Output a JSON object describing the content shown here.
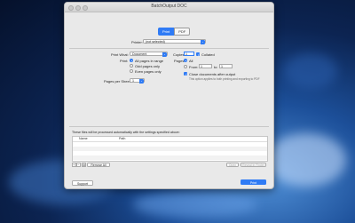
{
  "window": {
    "title": "BatchOutput DOC"
  },
  "tabs": [
    {
      "label": "Print"
    },
    {
      "label": "PDF"
    }
  ],
  "printer": {
    "label": "Printer:",
    "value": "(not selected)"
  },
  "print_what": {
    "label": "Print What:",
    "value": "Document"
  },
  "print": {
    "label": "Print:",
    "options": [
      {
        "label": "All pages in range",
        "selected": true
      },
      {
        "label": "Odd pages only",
        "selected": false
      },
      {
        "label": "Even pages only",
        "selected": false
      }
    ]
  },
  "pages_per_sheet": {
    "label": "Pages per Sheet:",
    "value": "1"
  },
  "copies": {
    "label": "Copies:",
    "value": "1",
    "collated_label": "Collated",
    "collated": true
  },
  "pages": {
    "label": "Pages:",
    "all_label": "All",
    "from_label": "From:",
    "to_label": "to:",
    "from_value": "1",
    "to_value": "1"
  },
  "show_documents": {
    "label": "Close documents after output",
    "checked": true
  },
  "note": "This option applies to both printing and exporting to PDF",
  "files": {
    "heading": "These files will be processed automatically with the settings specified above:",
    "columns": [
      "Name",
      "Path"
    ]
  },
  "list_buttons": {
    "add": "+",
    "remove": "−",
    "remove_all": "Remove All",
    "open": "Open",
    "reveal": "Reveal in Finder"
  },
  "footer": {
    "support": "Support",
    "print": "Print"
  },
  "colors": {
    "accent": "#2f7bf5"
  }
}
